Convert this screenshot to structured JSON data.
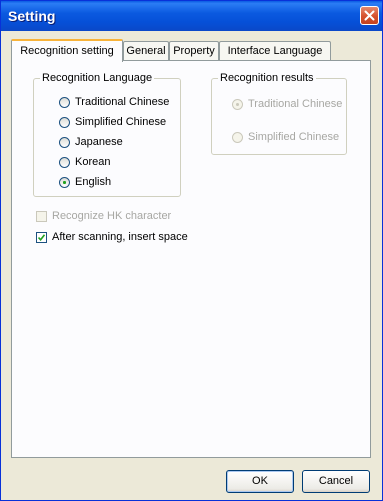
{
  "window": {
    "title": "Setting"
  },
  "tabs": [
    {
      "label": "Recognition setting",
      "active": true
    },
    {
      "label": "General",
      "active": false
    },
    {
      "label": "Property",
      "active": false
    },
    {
      "label": "Interface Language",
      "active": false
    }
  ],
  "recognition_language": {
    "title": "Recognition Language",
    "options": [
      {
        "label": "Traditional Chinese",
        "checked": false
      },
      {
        "label": "Simplified Chinese",
        "checked": false
      },
      {
        "label": "Japanese",
        "checked": false
      },
      {
        "label": "Korean",
        "checked": false
      },
      {
        "label": "English",
        "checked": true
      }
    ]
  },
  "recognition_results": {
    "title": "Recognition results",
    "options": [
      {
        "label": "Traditional Chinese",
        "checked": true,
        "disabled": true
      },
      {
        "label": "Simplified Chinese",
        "checked": false,
        "disabled": true
      }
    ]
  },
  "checkboxes": {
    "hk": {
      "label": "Recognize HK character",
      "checked": false,
      "disabled": true
    },
    "space": {
      "label": "After scanning, insert space",
      "checked": true,
      "disabled": false
    }
  },
  "buttons": {
    "ok": "OK",
    "cancel": "Cancel"
  },
  "icons": {
    "close": "close-icon",
    "checkmark": "checkmark-icon"
  },
  "colors": {
    "titlebar": "#0a5be3",
    "close_button": "#d6512d",
    "tab_highlight": "#f8b33a",
    "radio_dot": "#21a121"
  }
}
